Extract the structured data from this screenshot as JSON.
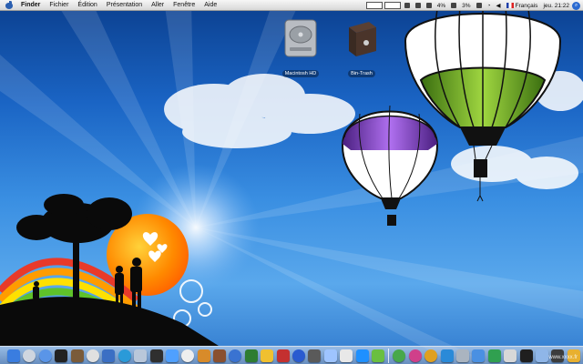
{
  "menubar": {
    "apple_icon": "apple-icon",
    "items": [
      {
        "label": "Finder",
        "bold": true
      },
      {
        "label": "Fichier"
      },
      {
        "label": "Édition"
      },
      {
        "label": "Présentation"
      },
      {
        "label": "Aller"
      },
      {
        "label": "Fenêtre"
      },
      {
        "label": "Aide"
      }
    ],
    "extras": {
      "battery_percent": "4%",
      "cpu_percent": "3%",
      "language": "Français",
      "clock": "jeu. 21:22"
    }
  },
  "desktop": {
    "icons": [
      {
        "label": "Macintosh HD",
        "icon": "hard-drive-icon"
      },
      {
        "label": "Bin-Trash",
        "icon": "trash-box-icon"
      }
    ],
    "wallpaper": {
      "sky_color": "#2f7fd8",
      "balloon_colors": [
        "#7fbf2a",
        "#8a3fc9",
        "#ffffff"
      ],
      "sun_color": "#ff8a00"
    }
  },
  "dock": {
    "item_count_left": 24,
    "item_count_right": 15
  },
  "watermark": "www.xxxx.fr"
}
